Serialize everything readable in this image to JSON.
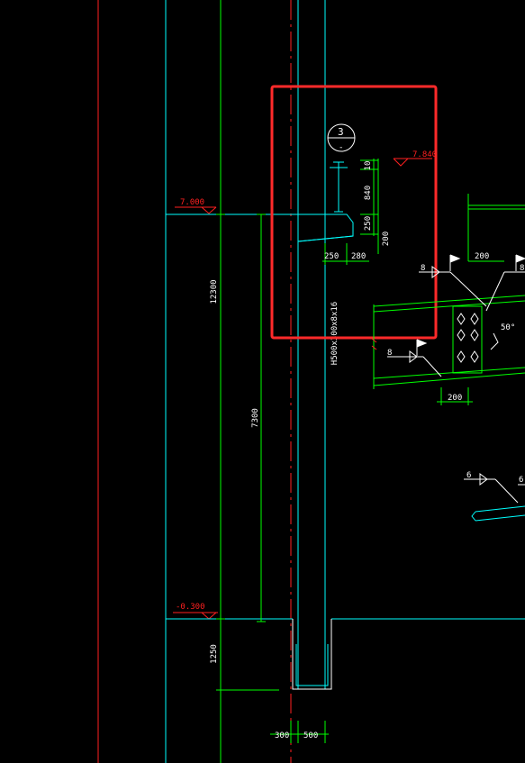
{
  "drawing": {
    "detail_marker": "3",
    "detail_marker_sub": "-",
    "elevations": {
      "top_beam": "7.840",
      "left_mid": "7.000",
      "ground": "-0.300"
    },
    "dimensions": {
      "total_height": "12300",
      "mid_height": "7300",
      "footing_depth": "1250",
      "stub_840": "840",
      "seat_250v": "250",
      "seat_200v": "200",
      "top_small": "10",
      "seat_250h": "250",
      "seat_280h": "280",
      "base_300": "300",
      "base_500": "500",
      "conn_top_200": "200",
      "conn_bot_200": "200"
    },
    "column_label": "H500x300x8x16",
    "weld_labels": {
      "w1": "8",
      "w2": "8",
      "w3": "8",
      "w4": "6",
      "w5": "6"
    },
    "angle_label": "50°",
    "colors": {
      "background": "#000000",
      "red": "#ff2020",
      "green": "#00ff00",
      "cyan": "#00ffff",
      "white": "#ffffff",
      "highlight_box": "#ff2a2a"
    }
  }
}
